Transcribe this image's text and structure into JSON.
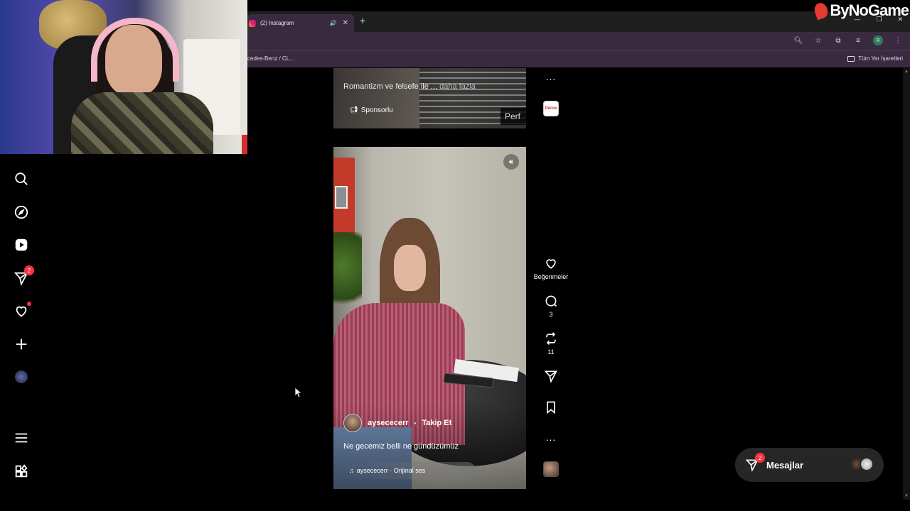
{
  "browser": {
    "tab_title": "(2) Instagram",
    "audio_icon": "speaker-icon",
    "close_glyph": "✕",
    "new_tab_glyph": "+",
    "bookmark_left": "cedes-Benz / CL...",
    "bookmark_right": "Tüm Yer İşaretleri",
    "profile_initial": "R"
  },
  "overlay": {
    "brand": "ByNoGame"
  },
  "sidebar": {
    "messages_badge": "2",
    "items": [
      "search",
      "explore",
      "reels",
      "messages",
      "notifications",
      "create",
      "profile",
      "more",
      "also-from-meta"
    ]
  },
  "prev_reel": {
    "caption": "Romantizm ve felsefe ile ...",
    "caption_more": "daha fazla",
    "sponsored": "Sponsorlu",
    "perf": "Perf",
    "advertiser_thumb": "Peros"
  },
  "reel": {
    "author": "aysececerr",
    "separator": "•",
    "follow": "Takip Et",
    "caption": "Ne gecemiz belli ne gündüzümüz",
    "audio": "aysececerr · Orijinal ses"
  },
  "actions": {
    "likes_label": "Beğenmeler",
    "comments": "3",
    "reposts": "11",
    "more": "..."
  },
  "messages": {
    "label": "Mesajlar",
    "badge": "2"
  },
  "colors": {
    "badge_red": "#ff3040",
    "tab_bg": "#3a2a3f",
    "brand_red": "#e53935"
  }
}
